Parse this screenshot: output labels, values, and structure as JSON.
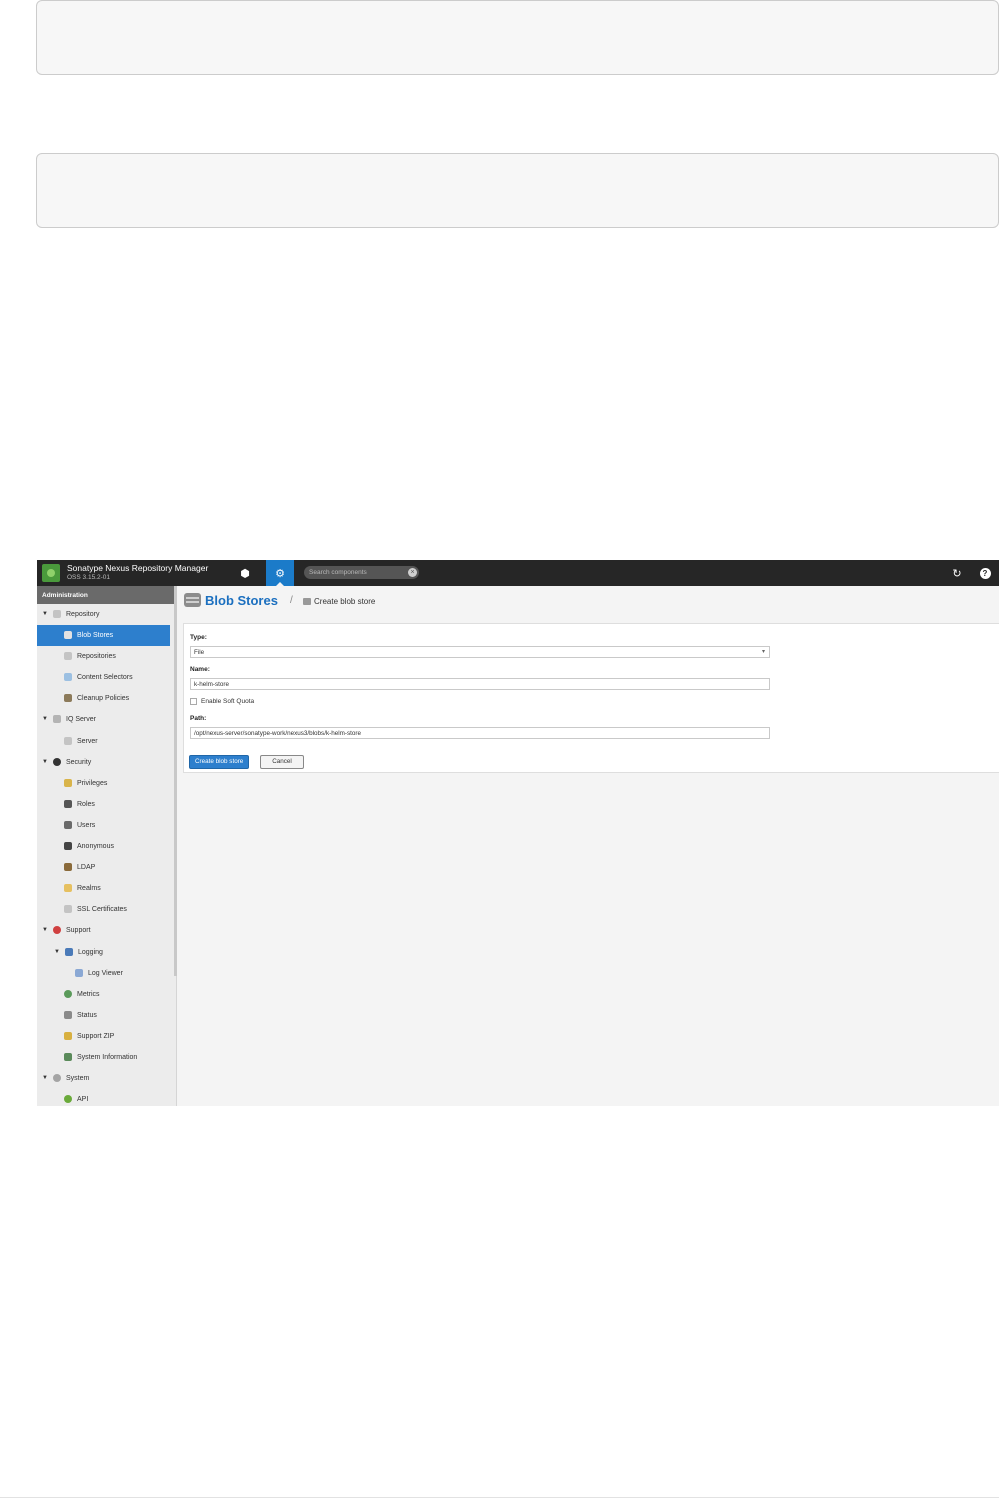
{
  "header": {
    "app_title": "Sonatype Nexus Repository Manager",
    "version": "OSS 3.15.2-01",
    "search_placeholder": "Search components"
  },
  "sidebar": {
    "heading": "Administration",
    "items": [
      {
        "label": "Repository",
        "icon": "database-icon",
        "color": "#b0b0b0"
      },
      {
        "label": "Blob Stores",
        "icon": "blob-store-icon",
        "color": "#d9d9d9",
        "selected": true
      },
      {
        "label": "Repositories",
        "icon": "database-icon",
        "color": "#b0b0b0"
      },
      {
        "label": "Content Selectors",
        "icon": "content-selector-icon",
        "color": "#7aa9d6"
      },
      {
        "label": "Cleanup Policies",
        "icon": "broom-icon",
        "color": "#8c7a5a"
      },
      {
        "label": "IQ Server",
        "icon": "iq-server-icon",
        "color": "#9a9a9a"
      },
      {
        "label": "Server",
        "icon": "server-icon",
        "color": "#b0b0b0"
      },
      {
        "label": "Security",
        "icon": "eye-icon",
        "color": "#333333"
      },
      {
        "label": "Privileges",
        "icon": "privileges-icon",
        "color": "#d9b44a"
      },
      {
        "label": "Roles",
        "icon": "roles-icon",
        "color": "#555555"
      },
      {
        "label": "Users",
        "icon": "users-icon",
        "color": "#666666"
      },
      {
        "label": "Anonymous",
        "icon": "anonymous-icon",
        "color": "#444444"
      },
      {
        "label": "LDAP",
        "icon": "ldap-icon",
        "color": "#8a6a3a"
      },
      {
        "label": "Realms",
        "icon": "realms-icon",
        "color": "#e0b040"
      },
      {
        "label": "SSL Certificates",
        "icon": "certificate-icon",
        "color": "#b8b8b8"
      },
      {
        "label": "Support",
        "icon": "support-icon",
        "color": "#d04040"
      },
      {
        "label": "Logging",
        "icon": "logging-icon",
        "color": "#4a7ab8"
      },
      {
        "label": "Log Viewer",
        "icon": "log-viewer-icon",
        "color": "#7a9acc"
      },
      {
        "label": "Metrics",
        "icon": "metrics-icon",
        "color": "#5a9a5a"
      },
      {
        "label": "Status",
        "icon": "status-icon",
        "color": "#8a8a8a"
      },
      {
        "label": "Support ZIP",
        "icon": "zip-icon",
        "color": "#d8b040"
      },
      {
        "label": "System Information",
        "icon": "system-info-icon",
        "color": "#5a8a5a"
      },
      {
        "label": "System",
        "icon": "system-icon",
        "color": "#9a9a9a"
      },
      {
        "label": "API",
        "icon": "api-icon",
        "color": "#6aaa3a"
      }
    ]
  },
  "breadcrumb": {
    "title": "Blob Stores",
    "separator": "/",
    "current": "Create blob store"
  },
  "form": {
    "type_label": "Type:",
    "type_value": "File",
    "name_label": "Name:",
    "name_value": "k-helm-store",
    "soft_quota_label": "Enable Soft Quota",
    "path_label": "Path:",
    "path_value": "/opt/nexus-server/sonatype-work/nexus3/blobs/k-helm-store",
    "create_button": "Create blob store",
    "cancel_button": "Cancel"
  }
}
